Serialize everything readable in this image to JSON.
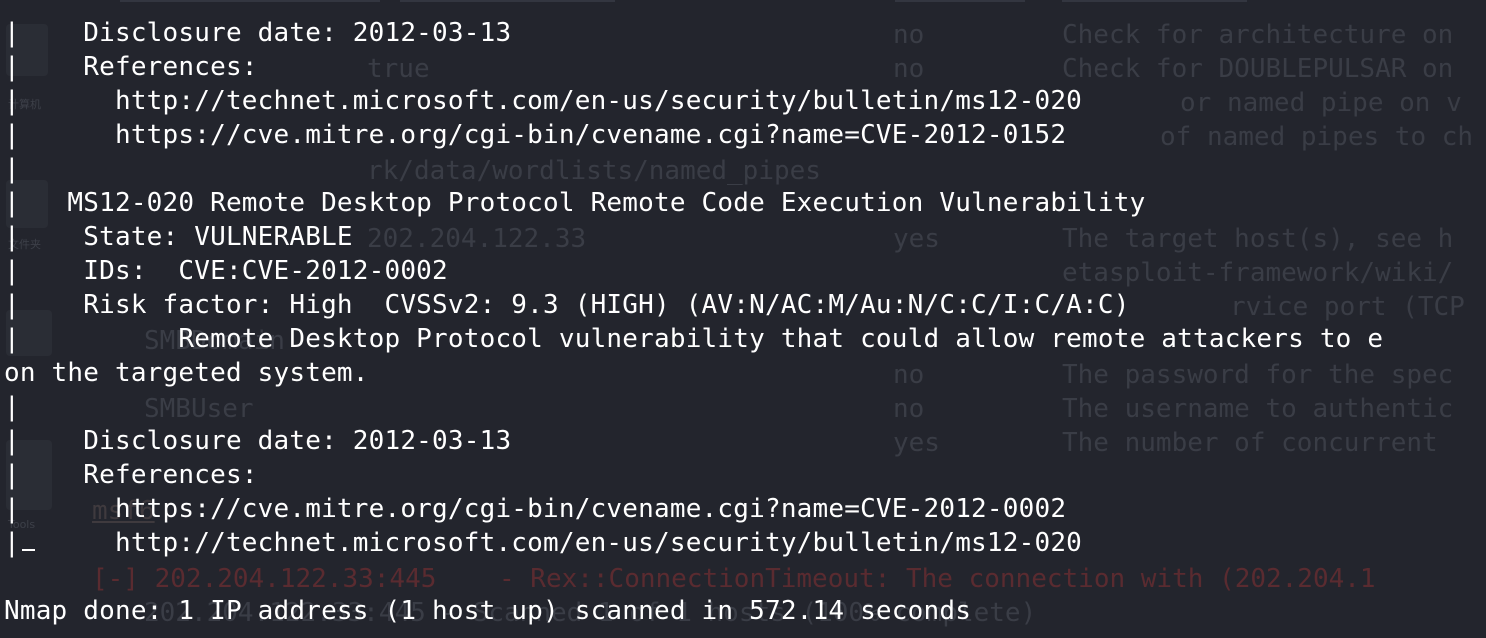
{
  "terminal": {
    "lines": [
      "|    Disclosure date: 2012-03-13",
      "|    References:",
      "|      http://technet.microsoft.com/en-us/security/bulletin/ms12-020",
      "|      https://cve.mitre.org/cgi-bin/cvename.cgi?name=CVE-2012-0152",
      "|",
      "|   MS12-020 Remote Desktop Protocol Remote Code Execution Vulnerability",
      "|    State: VULNERABLE",
      "|    IDs:  CVE:CVE-2012-0002",
      "|    Risk factor: High  CVSSv2: 9.3 (HIGH) (AV:N/AC:M/Au:N/C:C/I:C/A:C)",
      "|          Remote Desktop Protocol vulnerability that could allow remote attackers to e",
      "on the targeted system.",
      "|",
      "|    Disclosure date: 2012-03-13",
      "|    References:",
      "|      https://cve.mitre.org/cgi-bin/cvename.cgi?name=CVE-2012-0002",
      "|      http://technet.microsoft.com/en-us/security/bulletin/ms12-020",
      "",
      "Nmap done: 1 IP address (1 host up) scanned in 572.14 seconds"
    ],
    "cursor_line_prefix": "|"
  },
  "background_terminal": {
    "col1": [
      "true",
      "rk/data/wordlists/named_pipes",
      "202.204.122.33",
      "SMBDomain",
      "SMBUser"
    ],
    "col2": [
      "no",
      "no",
      "yes",
      "no",
      "no",
      "yes"
    ],
    "col3": [
      "Check for architecture on",
      "Check for DOUBLEPULSAR on",
      "or named pipe on v",
      "of named pipes to ch",
      "The target host(s), see h",
      "etasploit-framework/wiki/",
      "rvice port (TCP",
      "The password for the spec",
      "The username to authentic",
      "The number of concurrent"
    ],
    "prompt": "msf6",
    "error_line": "[-] 202.204.122.33:445    - Rex::ConnectionTimeout: The connection with (202.204.1",
    "status_line": "202.204.122.33:445 - Scanned 1 of 1 hosts (100% complete)"
  },
  "desktop": {
    "icon_labels": [
      "计算机",
      "文件夹",
      "Tools"
    ]
  }
}
